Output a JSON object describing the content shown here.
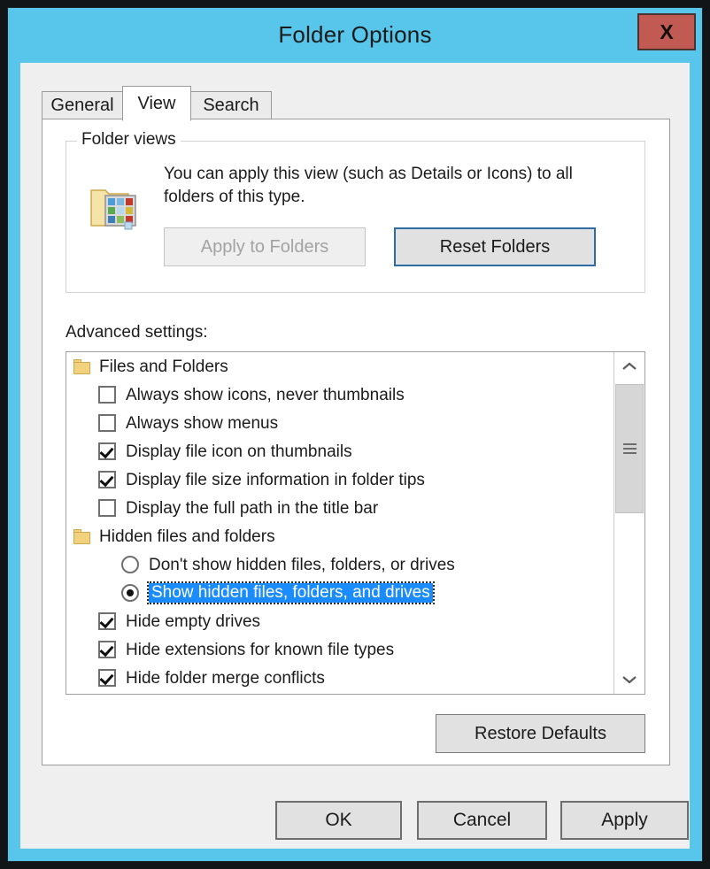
{
  "window": {
    "title": "Folder Options",
    "close_label": "X",
    "accent_color": "#57c6ea",
    "close_color": "#c15a53"
  },
  "tabs": [
    {
      "label": "General",
      "active": false
    },
    {
      "label": "View",
      "active": true
    },
    {
      "label": "Search",
      "active": false
    }
  ],
  "folder_views": {
    "legend": "Folder views",
    "icon": "folder-views-icon",
    "description": "You can apply this view (such as Details or Icons) to all folders of this type.",
    "apply_to_folders_label": "Apply to Folders",
    "apply_to_folders_enabled": false,
    "reset_folders_label": "Reset Folders",
    "reset_folders_focused": true,
    "focus_color": "#2e6ca4"
  },
  "advanced": {
    "label": "Advanced settings:",
    "selection_color": "#1a8cff",
    "rows": [
      {
        "type": "group",
        "label": "Files and Folders",
        "icon": "folder-icon"
      },
      {
        "type": "checkbox",
        "label": "Always show icons, never thumbnails",
        "checked": false
      },
      {
        "type": "checkbox",
        "label": "Always show menus",
        "checked": false
      },
      {
        "type": "checkbox",
        "label": "Display file icon on thumbnails",
        "checked": true
      },
      {
        "type": "checkbox",
        "label": "Display file size information in folder tips",
        "checked": true
      },
      {
        "type": "checkbox",
        "label": "Display the full path in the title bar",
        "checked": false
      },
      {
        "type": "group",
        "label": "Hidden files and folders",
        "icon": "folder-icon"
      },
      {
        "type": "radio",
        "label": "Don't show hidden files, folders, or drives",
        "checked": false
      },
      {
        "type": "radio",
        "label": "Show hidden files, folders, and drives",
        "checked": true,
        "selected": true
      },
      {
        "type": "checkbox",
        "label": "Hide empty drives",
        "checked": true
      },
      {
        "type": "checkbox",
        "label": "Hide extensions for known file types",
        "checked": true
      },
      {
        "type": "checkbox",
        "label": "Hide folder merge conflicts",
        "checked": true
      }
    ],
    "scrollbar": {
      "up_icon": "chevron-up-icon",
      "down_icon": "chevron-down-icon",
      "thumb_icon": "scroll-thumb-grip"
    }
  },
  "restore_defaults_label": "Restore Defaults",
  "bottom_buttons": {
    "ok_label": "OK",
    "cancel_label": "Cancel",
    "apply_label": "Apply"
  }
}
